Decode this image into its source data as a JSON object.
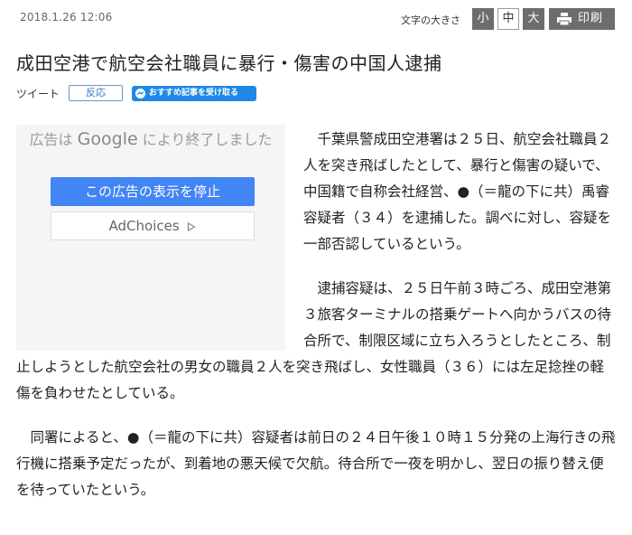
{
  "header": {
    "date": "2018.1.26 12:06",
    "font_size_label": "文字の大きさ",
    "size_small": "小",
    "size_medium": "中",
    "size_large": "大",
    "print_label": "印刷"
  },
  "article": {
    "title": "成田空港で航空会社職員に暴行・傷害の中国人逮捕",
    "paragraphs": [
      "千葉県警成田空港署は２５日、航空会社職員２人を突き飛ばしたとして、暴行と傷害の疑いで、中国籍で自称会社経営、●（＝龍の下に共）禹睿容疑者（３４）を逮捕した。調べに対し、容疑を一部否認しているという。",
      "逮捕容疑は、２５日午前３時ごろ、成田空港第３旅客ターミナルの搭乗ゲートへ向かうバスの待合所で、制限区域に立ち入ろうとしたところ、制止しようとした航空会社の男女の職員２人を突き飛ばし、女性職員（３６）には左足捻挫の軽傷を負わせたとしている。",
      "同署によると、●（＝龍の下に共）容疑者は前日の２４日午後１０時１５分発の上海行きの飛行機に搭乗予定だったが、到着地の悪天候で欠航。待合所で一夜を明かし、翌日の振り替え便を待っていたという。"
    ]
  },
  "share": {
    "tweet_label": "ツイート",
    "react_label": "反応",
    "messenger_label": "おすすめ記事を受け取る"
  },
  "ad": {
    "message_prefix": "広告は",
    "message_brand": "Google",
    "message_suffix": "により終了しました",
    "stop_label": "この広告の表示を停止",
    "choices_label": "AdChoices"
  },
  "icons": {
    "print": "printer-icon",
    "messenger": "messenger-icon",
    "adchoices": "adchoices-icon"
  },
  "colors": {
    "button_dark": "#6d6d6d",
    "ad_blue": "#4285f4",
    "messenger_blue": "#1e88e5",
    "react_border": "#5b9bd5"
  }
}
